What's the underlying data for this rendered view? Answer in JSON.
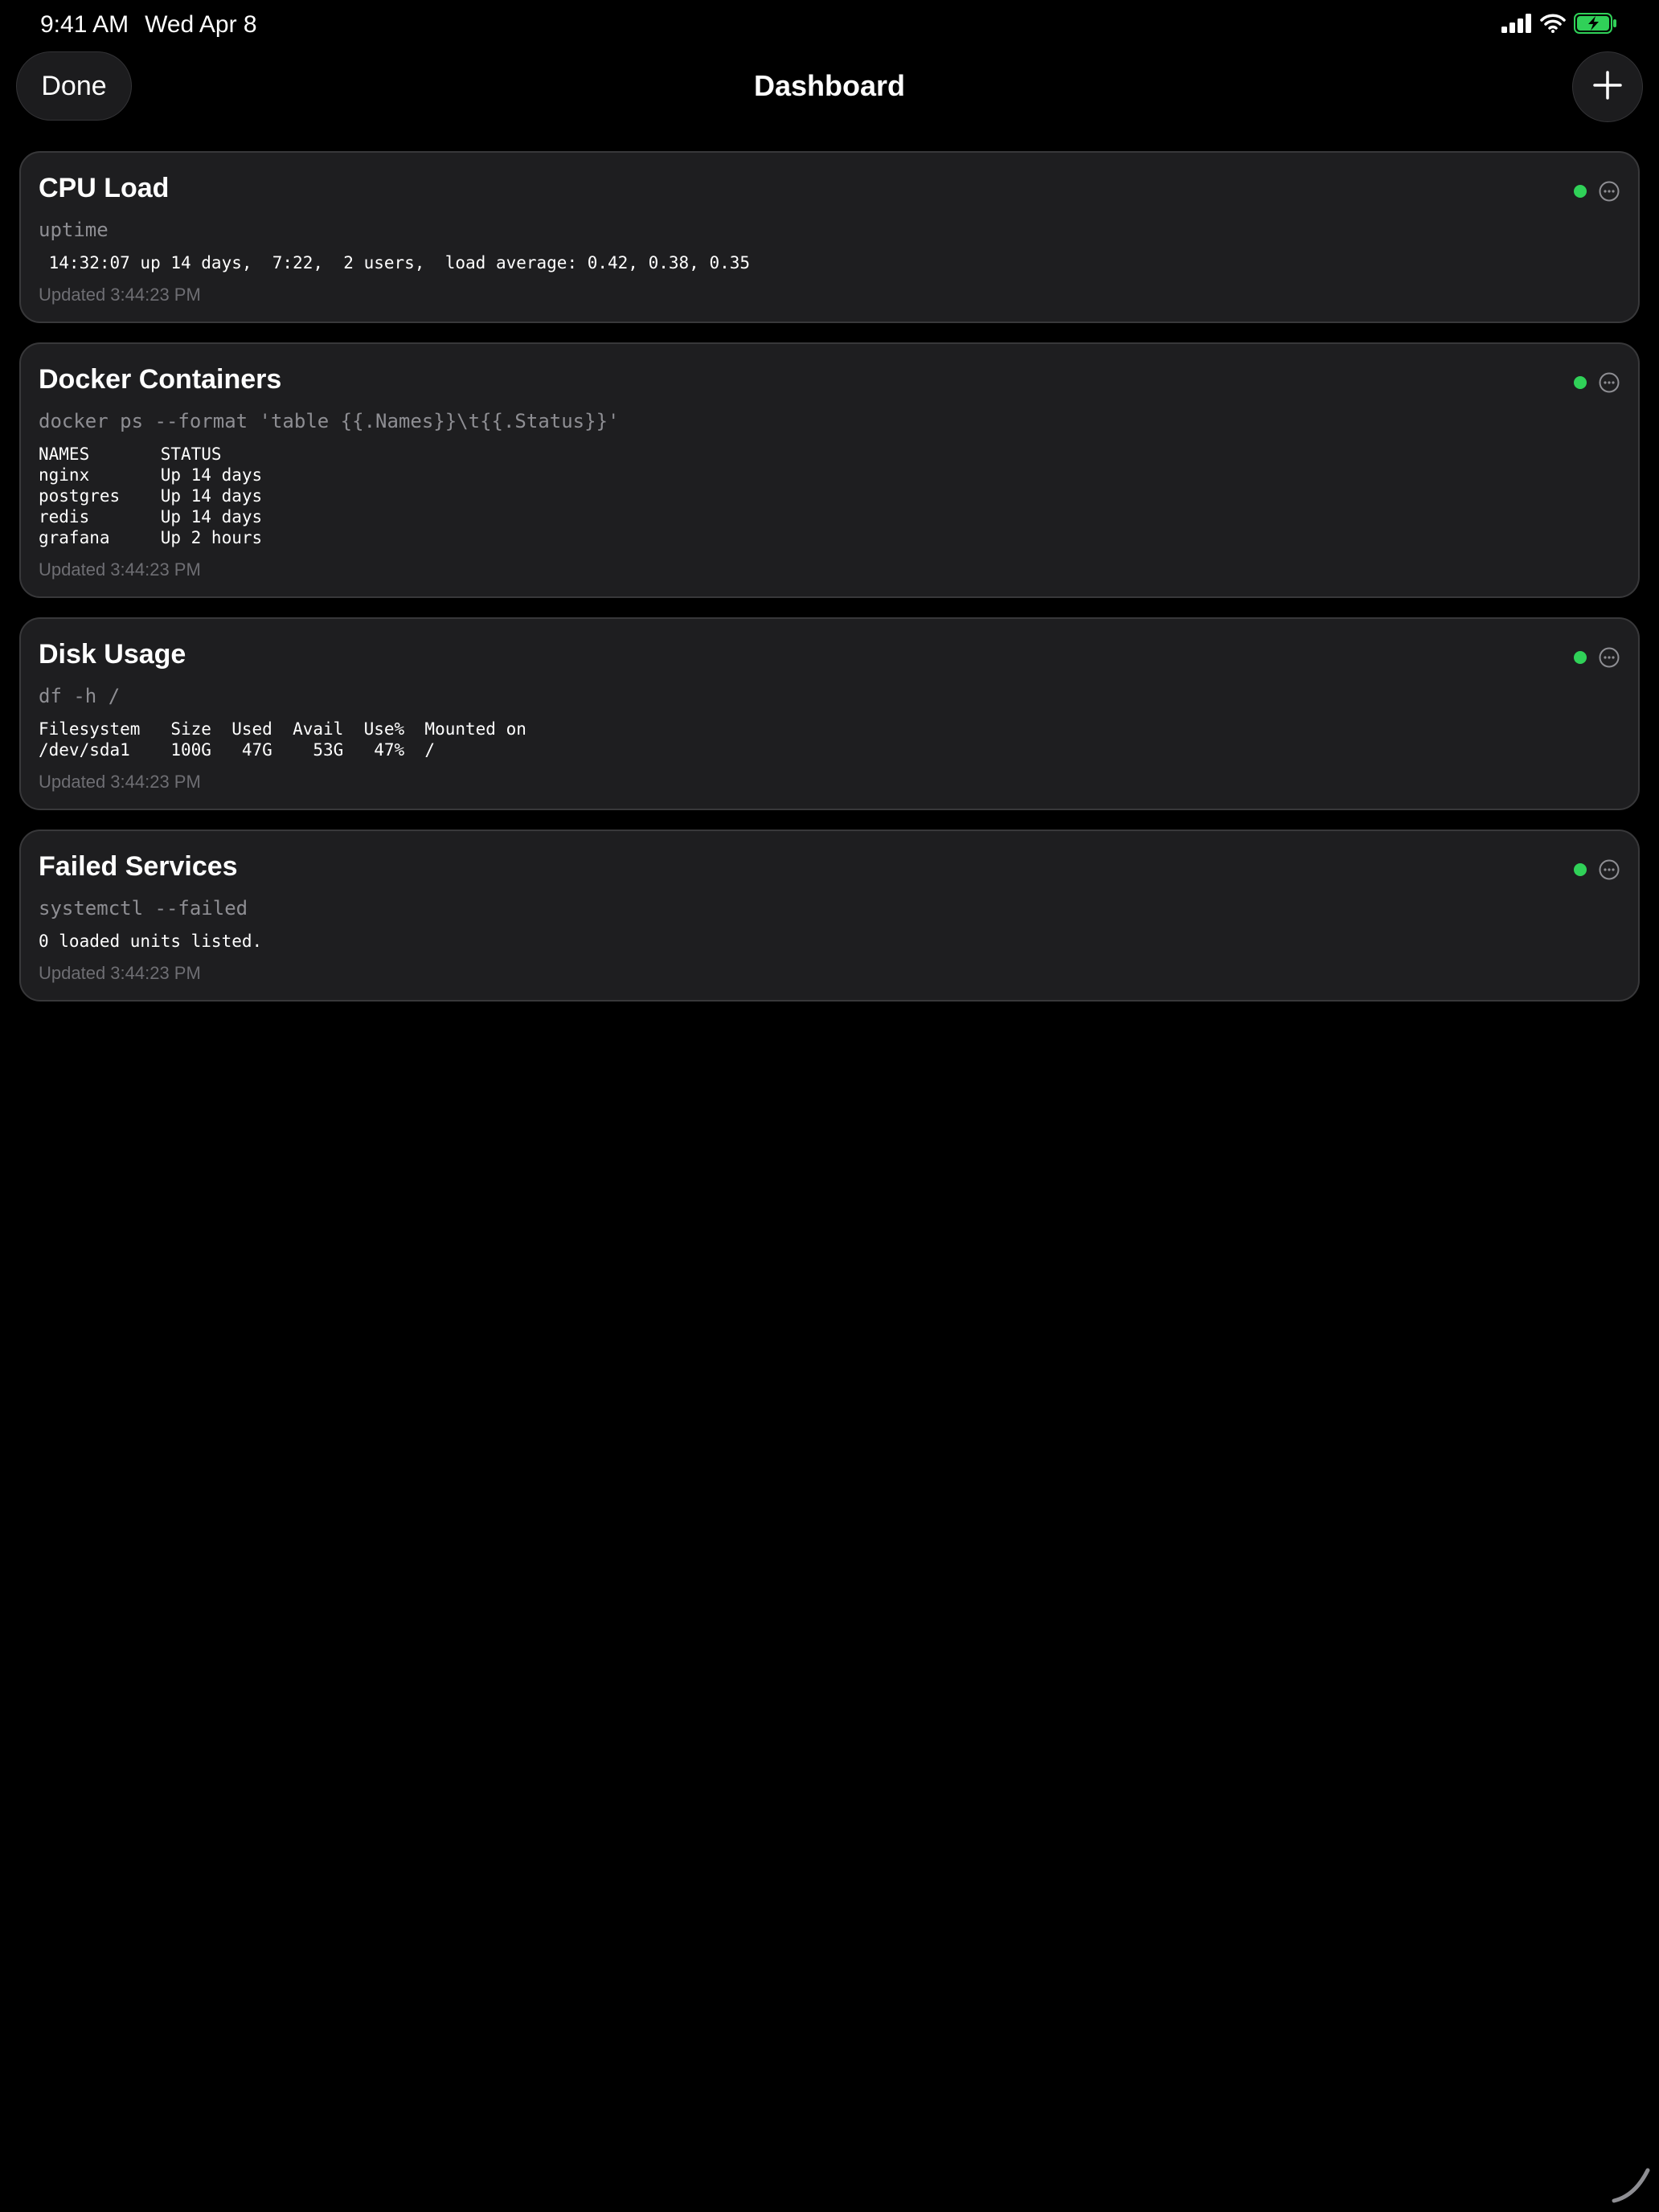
{
  "status_bar": {
    "time": "9:41 AM",
    "date": "Wed Apr 8",
    "icons": [
      "signal-icon",
      "wifi-icon",
      "battery-charging-icon"
    ],
    "battery_color": "#30d158"
  },
  "nav": {
    "done_label": "Done",
    "title": "Dashboard",
    "add_icon": "plus-icon"
  },
  "cards": [
    {
      "title": "CPU Load",
      "command": "uptime",
      "output": " 14:32:07 up 14 days,  7:22,  2 users,  load average: 0.42, 0.38, 0.35",
      "updated": "Updated 3:44:23 PM",
      "status": "ok"
    },
    {
      "title": "Docker Containers",
      "command": "docker ps --format 'table {{.Names}}\\t{{.Status}}'",
      "output": "NAMES       STATUS\nnginx       Up 14 days\npostgres    Up 14 days\nredis       Up 14 days\ngrafana     Up 2 hours",
      "updated": "Updated 3:44:23 PM",
      "status": "ok"
    },
    {
      "title": "Disk Usage",
      "command": "df -h /",
      "output": "Filesystem   Size  Used  Avail  Use%  Mounted on\n/dev/sda1    100G   47G    53G   47%  /",
      "updated": "Updated 3:44:23 PM",
      "status": "ok"
    },
    {
      "title": "Failed Services",
      "command": "systemctl --failed",
      "output": "0 loaded units listed.",
      "updated": "Updated 3:44:23 PM",
      "status": "ok"
    }
  ],
  "colors": {
    "background": "#000000",
    "card": "#1e1e20",
    "status_ok": "#30d158",
    "muted_text": "#8e8e93"
  }
}
